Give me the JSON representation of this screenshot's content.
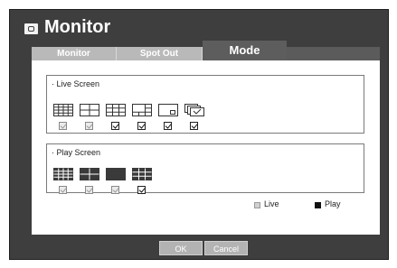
{
  "title": "Monitor",
  "tabs": {
    "monitor": "Monitor",
    "spot_out": "Spot Out",
    "mode": "Mode"
  },
  "live_screen": {
    "label": "· Live Screen",
    "layouts": [
      {
        "icon": "grid-4x4-layout-icon",
        "checked": false
      },
      {
        "icon": "grid-2x2-layout-icon",
        "checked": false
      },
      {
        "icon": "grid-3x3-layout-icon",
        "checked": true
      },
      {
        "icon": "grid-1-plus-5-layout-icon",
        "checked": true
      },
      {
        "icon": "pip-layout-icon",
        "checked": true
      },
      {
        "icon": "sequence-layout-icon",
        "checked": true
      }
    ]
  },
  "play_screen": {
    "label": "· Play Screen",
    "layouts": [
      {
        "icon": "grid-4x4-layout-icon",
        "checked": false
      },
      {
        "icon": "grid-2x2-layout-icon",
        "checked": false
      },
      {
        "icon": "single-layout-icon",
        "checked": false
      },
      {
        "icon": "grid-3x3-layout-icon",
        "checked": true
      }
    ]
  },
  "legend": {
    "live": "Live",
    "play": "Play",
    "live_color": "#d0d0d0",
    "play_color": "#111111"
  },
  "buttons": {
    "ok": "OK",
    "cancel": "Cancel"
  },
  "colors": {
    "frame": "#3e3e3e",
    "tab_inactive": "#b9b9b9",
    "tab_active": "#5d5d5d",
    "button": "#b3b3b3"
  }
}
